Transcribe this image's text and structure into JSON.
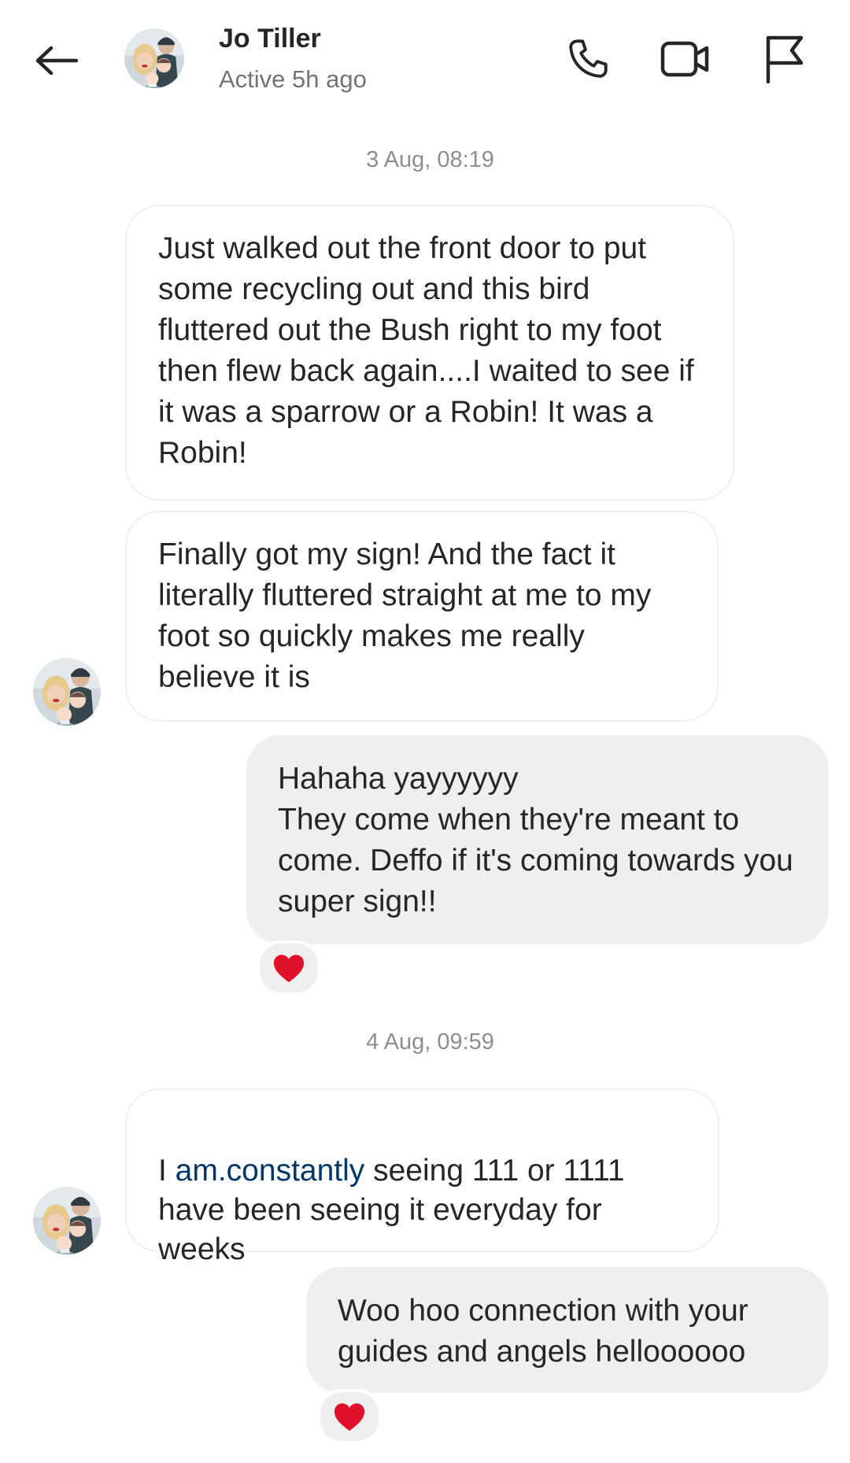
{
  "header": {
    "contact_name": "Jo Tiller",
    "status": "Active 5h ago"
  },
  "icons": {
    "back": "arrow-left-icon",
    "call": "phone-icon",
    "video": "video-camera-icon",
    "report": "flag-icon",
    "reaction": "red-heart-icon"
  },
  "colors": {
    "incoming_bubble": "#ffffff",
    "outgoing_bubble": "#efefef",
    "link": "#00376b",
    "heart": "#e0112b"
  },
  "conversation": {
    "timestamp_1": "3 Aug, 08:19",
    "msg_1": "Just walked out the front door to put some recycling out and this bird fluttered out the Bush right to my foot then flew back again....I waited to see if it was a sparrow or a Robin! It was a Robin!",
    "msg_2": "Finally got my sign! And the fact it literally fluttered straight at me to my foot so quickly makes me really believe it is",
    "msg_3": "Hahaha yayyyyyy\nThey come when they're meant to come. Deffo if it's coming towards you super sign!!",
    "msg_3_reaction": "❤",
    "timestamp_2": "4 Aug, 09:59",
    "msg_4_prefix": "I ",
    "msg_4_link": "am.constantly",
    "msg_4_suffix": " seeing 111 or 1111 have been seeing it everyday for weeks",
    "msg_5": "Woo hoo connection with your guides and angels helloooooo",
    "msg_5_reaction": "❤"
  }
}
